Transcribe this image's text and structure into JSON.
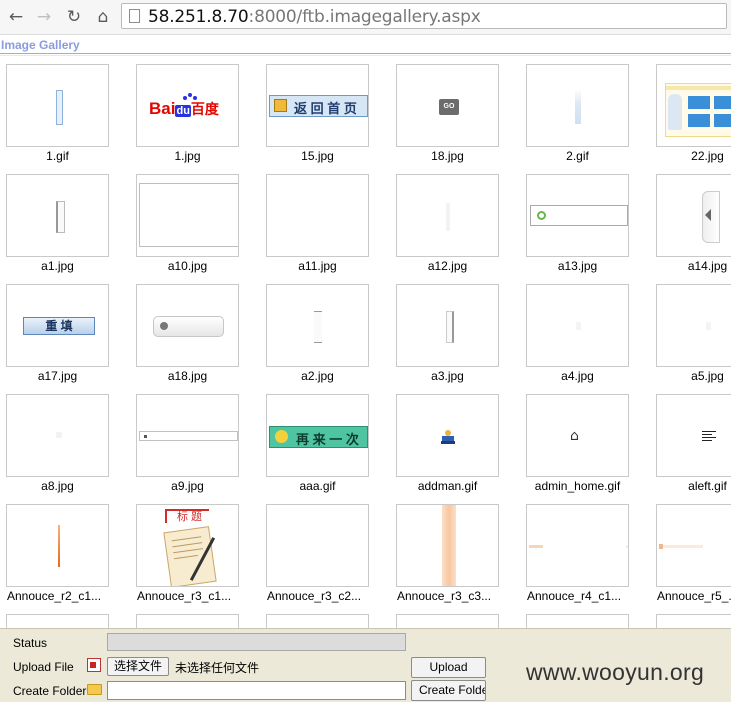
{
  "browser": {
    "url_host": "58.251.8.70",
    "url_rest": ":8000/ftb.imagegallery.aspx",
    "back_icon": "←",
    "forward_icon": "→",
    "reload_icon": "↻",
    "home_icon": "⌂"
  },
  "gallery": {
    "title": "Image Gallery",
    "files": [
      "1.gif",
      "1.jpg",
      "15.jpg",
      "18.jpg",
      "2.gif",
      "22.jpg",
      "a1.jpg",
      "a10.jpg",
      "a11.jpg",
      "a12.jpg",
      "a13.jpg",
      "a14.jpg",
      "a17.jpg",
      "a18.jpg",
      "a2.jpg",
      "a3.jpg",
      "a4.jpg",
      "a5.jpg",
      "a8.jpg",
      "a9.jpg",
      "aaa.gif",
      "addman.gif",
      "admin_home.gif",
      "aleft.gif",
      "Annouce_r2_c1...",
      "Annouce_r3_c1...",
      "Annouce_r3_c2...",
      "Annouce_r3_c3...",
      "Annouce_r4_c1...",
      "Annouce_r5_..."
    ],
    "thumb_text": {
      "baidu_red": "Bai",
      "baidu_du": "du",
      "baidu_cn": "百度",
      "back_home": "返 回 首 页",
      "go": "GO",
      "reset": "重 填",
      "again": "再 来 一 次",
      "label_title": "标 题"
    }
  },
  "panel": {
    "status_label": "Status",
    "upload_label": "Upload File",
    "choose_button": "选择文件",
    "no_file_text": "未选择任何文件",
    "upload_button": "Upload",
    "create_label": "Create Folder",
    "create_button": "Create Folder"
  },
  "watermark": "www.wooyun.org"
}
